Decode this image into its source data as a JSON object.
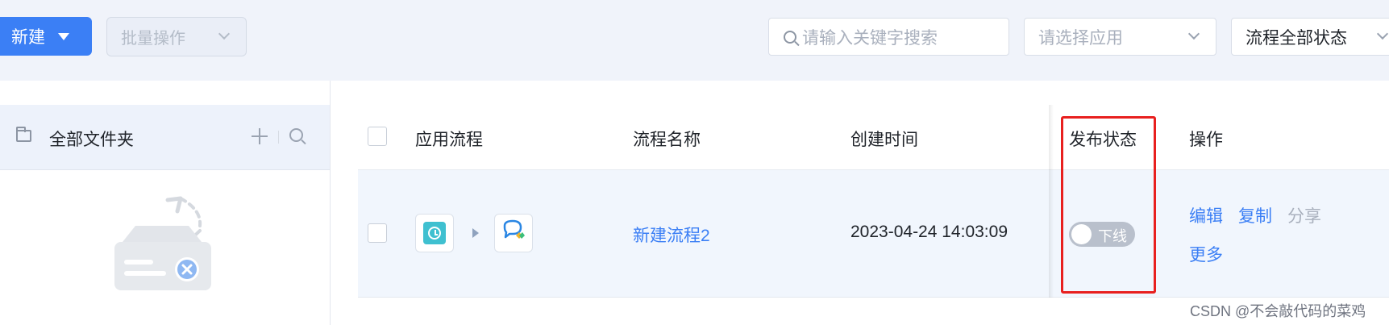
{
  "toolbar": {
    "new_label": "新建",
    "batch_label": "批量操作",
    "search_placeholder": "请输入关键字搜索",
    "app_select_placeholder": "请选择应用",
    "status_select_value": "流程全部状态"
  },
  "sidebar": {
    "folder_label": "全部文件夹"
  },
  "table": {
    "headers": [
      "应用流程",
      "流程名称",
      "创建时间",
      "发布状态",
      "操作"
    ],
    "rows": [
      {
        "app_icons": [
          "clock-icon",
          "chat-icon"
        ],
        "name": "新建流程2",
        "created": "2023-04-24 14:03:09",
        "status_label": "下线",
        "status_on": false,
        "actions": [
          "编辑",
          "复制",
          "分享",
          "更多"
        ]
      }
    ]
  },
  "colors": {
    "accent": "#3b7ff5",
    "highlight": "#e8201f",
    "toggle_off": "#b9c0cc",
    "clock_tile": "#3fc0d0"
  },
  "watermark": "CSDN @不会敲代码的菜鸡"
}
